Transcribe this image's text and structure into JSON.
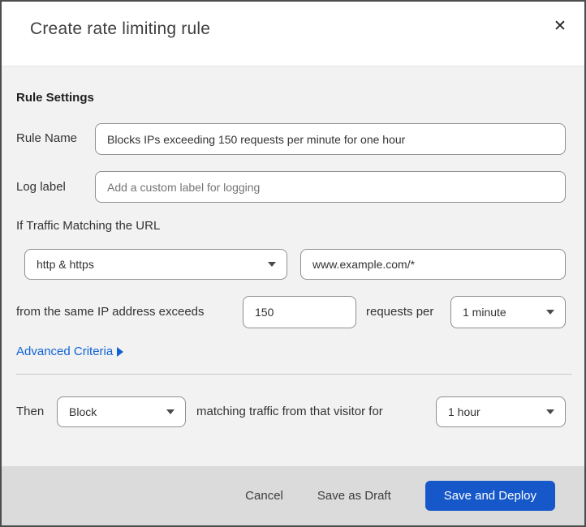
{
  "modal": {
    "title": "Create rate limiting rule",
    "close_glyph": "✕"
  },
  "body": {
    "section_heading": "Rule Settings",
    "rule_name": {
      "label": "Rule Name",
      "value": "Blocks IPs exceeding 150 requests per minute for one hour"
    },
    "log_label": {
      "label": "Log label",
      "placeholder": "Add a custom label for logging"
    },
    "traffic_match": {
      "intro": "If Traffic Matching the URL",
      "scheme_selected": "http & https",
      "url_value": "www.example.com/*"
    },
    "threshold": {
      "prefix": "from the same IP address exceeds",
      "count_value": "150",
      "middle": "requests per",
      "period_selected": "1 minute"
    },
    "advanced_criteria": {
      "label": "Advanced Criteria"
    }
  },
  "action_row": {
    "then_label": "Then",
    "action_selected": "Block",
    "middle": "matching traffic from that visitor for",
    "duration_selected": "1 hour"
  },
  "footer": {
    "cancel_label": "Cancel",
    "save_draft_label": "Save as Draft",
    "save_deploy_label": "Save and Deploy"
  },
  "colors": {
    "link_blue": "#0f62d6",
    "primary_button_blue": "#1658c9",
    "body_background": "#f2f2f2",
    "footer_background": "#dbdbdb",
    "top_strip": "#0b2130",
    "frame_border": "#4d4d4d"
  }
}
